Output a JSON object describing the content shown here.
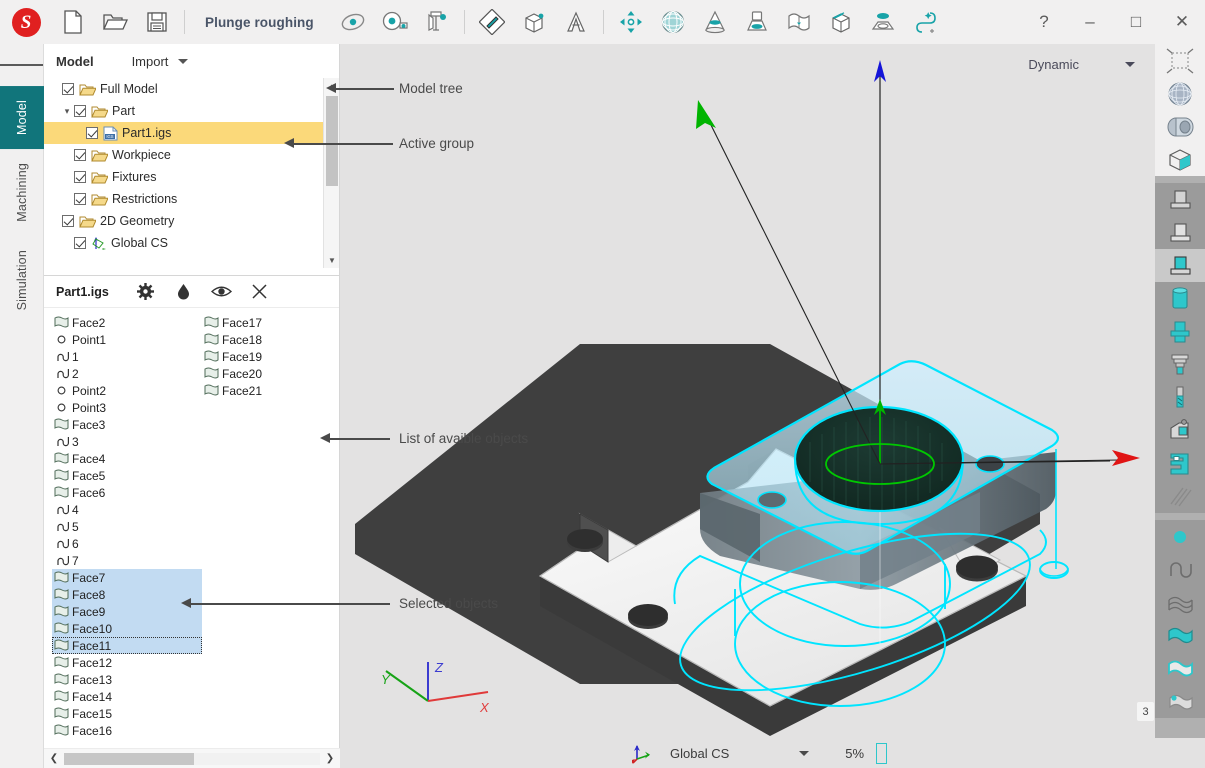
{
  "titlebar": {
    "logo_letter": "S",
    "document_title": "Plunge roughing",
    "left_icons": [
      {
        "name": "new-file-icon"
      },
      {
        "name": "open-folder-icon"
      },
      {
        "name": "save-icon"
      }
    ],
    "center_icons": [
      {
        "name": "measure-distance-icon"
      },
      {
        "name": "measure-tape-icon"
      },
      {
        "name": "caliper-icon"
      },
      {
        "name": "sketch-pencil-icon"
      },
      {
        "name": "solid-box-icon"
      },
      {
        "name": "text-annotation-icon"
      },
      {
        "name": "move-transform-icon"
      },
      {
        "name": "mesh-sphere-icon"
      },
      {
        "name": "cone-icon"
      },
      {
        "name": "turn-stock-icon"
      },
      {
        "name": "surface-wave-icon"
      },
      {
        "name": "extrude-box-icon"
      },
      {
        "name": "pocket-icon"
      },
      {
        "name": "toolpath-curve-icon"
      }
    ],
    "window_buttons": [
      {
        "name": "help-button",
        "glyph": "?"
      },
      {
        "name": "minimize-button",
        "glyph": "–"
      },
      {
        "name": "maximize-button",
        "glyph": "□"
      },
      {
        "name": "close-button",
        "glyph": "✕"
      }
    ]
  },
  "rail": {
    "menu_icon": "hamburger-menu-icon",
    "tabs": [
      {
        "label": "Model",
        "active": true
      },
      {
        "label": "Machining",
        "active": false
      },
      {
        "label": "Simulation",
        "active": false
      }
    ]
  },
  "tree_panel": {
    "title": "Model",
    "import_label": "Import",
    "items": [
      {
        "label": "Full Model",
        "indent": 0,
        "icon": "folder-icon",
        "checked": true,
        "twist": "",
        "selected": false
      },
      {
        "label": "Part",
        "indent": 1,
        "icon": "folder-icon",
        "checked": true,
        "twist": "⌄",
        "selected": false
      },
      {
        "label": "Part1.igs",
        "indent": 2,
        "icon": "igs-file-icon",
        "checked": true,
        "twist": "",
        "selected": true
      },
      {
        "label": "Workpiece",
        "indent": 1,
        "icon": "folder-icon",
        "checked": true,
        "twist": "",
        "selected": false
      },
      {
        "label": "Fixtures",
        "indent": 1,
        "icon": "folder-icon",
        "checked": true,
        "twist": "",
        "selected": false
      },
      {
        "label": "Restrictions",
        "indent": 1,
        "icon": "folder-icon",
        "checked": true,
        "twist": "",
        "selected": false
      },
      {
        "label": "2D Geometry",
        "indent": 0,
        "icon": "folder-icon",
        "checked": true,
        "twist": "",
        "selected": false
      },
      {
        "label": "Global CS",
        "indent": 1,
        "icon": "coordinate-system-icon",
        "checked": true,
        "twist": "",
        "selected": false
      }
    ]
  },
  "object_panel": {
    "title": "Part1.igs",
    "header_icons": [
      {
        "name": "settings-gear-icon"
      },
      {
        "name": "color-drop-icon"
      },
      {
        "name": "visibility-eye-icon"
      },
      {
        "name": "close-panel-icon"
      }
    ],
    "column1": [
      {
        "label": "Face2",
        "icon": "face-icon",
        "state": "normal"
      },
      {
        "label": "Point1",
        "icon": "point-icon",
        "state": "normal"
      },
      {
        "label": "1",
        "icon": "curve-icon",
        "state": "normal"
      },
      {
        "label": "2",
        "icon": "curve-icon",
        "state": "normal"
      },
      {
        "label": "Point2",
        "icon": "point-icon",
        "state": "normal"
      },
      {
        "label": "Point3",
        "icon": "point-icon",
        "state": "normal"
      },
      {
        "label": "Face3",
        "icon": "face-icon",
        "state": "normal"
      },
      {
        "label": "3",
        "icon": "curve-icon",
        "state": "normal"
      },
      {
        "label": "Face4",
        "icon": "face-icon",
        "state": "normal"
      },
      {
        "label": "Face5",
        "icon": "face-icon",
        "state": "normal"
      },
      {
        "label": "Face6",
        "icon": "face-icon",
        "state": "normal"
      },
      {
        "label": "4",
        "icon": "curve-icon",
        "state": "normal"
      },
      {
        "label": "5",
        "icon": "curve-icon",
        "state": "normal"
      },
      {
        "label": "6",
        "icon": "curve-icon",
        "state": "normal"
      },
      {
        "label": "7",
        "icon": "curve-icon",
        "state": "normal"
      },
      {
        "label": "Face7",
        "icon": "face-icon",
        "state": "selected"
      },
      {
        "label": "Face8",
        "icon": "face-icon",
        "state": "selected"
      },
      {
        "label": "Face9",
        "icon": "face-icon",
        "state": "selected"
      },
      {
        "label": "Face10",
        "icon": "face-icon",
        "state": "selected"
      },
      {
        "label": "Face11",
        "icon": "face-icon",
        "state": "focused"
      },
      {
        "label": "Face12",
        "icon": "face-icon",
        "state": "normal"
      },
      {
        "label": "Face13",
        "icon": "face-icon",
        "state": "normal"
      },
      {
        "label": "Face14",
        "icon": "face-icon",
        "state": "normal"
      },
      {
        "label": "Face15",
        "icon": "face-icon",
        "state": "normal"
      },
      {
        "label": "Face16",
        "icon": "face-icon",
        "state": "normal"
      }
    ],
    "column2": [
      {
        "label": "Face17",
        "icon": "face-icon",
        "state": "normal"
      },
      {
        "label": "Face18",
        "icon": "face-icon",
        "state": "normal"
      },
      {
        "label": "Face19",
        "icon": "face-icon",
        "state": "normal"
      },
      {
        "label": "Face20",
        "icon": "face-icon",
        "state": "normal"
      },
      {
        "label": "Face21",
        "icon": "face-icon",
        "state": "normal"
      }
    ]
  },
  "viewport": {
    "view_mode": "Dynamic",
    "axis_labels": {
      "x": "X",
      "y": "Y",
      "z": "Z"
    },
    "status": {
      "cs_icon": "coordinate-system-icon",
      "cs_name": "Global CS",
      "zoom": "5%",
      "scale_bar_icon": "scale-bar-icon"
    }
  },
  "right_toolbar": {
    "groups": [
      {
        "theme": "light",
        "buttons": [
          {
            "name": "bounding-box-icon",
            "selected": false
          },
          {
            "name": "wireframe-sphere-icon",
            "selected": false
          },
          {
            "name": "shaded-solid-icon",
            "selected": false
          },
          {
            "name": "transparent-box-icon",
            "selected": false
          }
        ]
      },
      {
        "theme": "dark",
        "buttons": [
          {
            "name": "stock-model-gray-icon",
            "selected": false
          },
          {
            "name": "stock-model-outline-icon",
            "selected": false
          },
          {
            "name": "stock-model-teal-icon",
            "selected": true
          },
          {
            "name": "solid-cylinder-teal-icon",
            "selected": false
          },
          {
            "name": "stepped-cylinder-icon",
            "selected": false
          },
          {
            "name": "tool-holder-icon",
            "selected": false
          },
          {
            "name": "endmill-tool-icon",
            "selected": false
          },
          {
            "name": "machine-head-icon",
            "selected": false
          },
          {
            "name": "clamp-fixture-icon",
            "selected": false
          },
          {
            "name": "hatch-pattern-icon",
            "selected": false
          }
        ]
      },
      {
        "theme": "dark",
        "buttons": [
          {
            "name": "point-dot-icon",
            "selected": false
          },
          {
            "name": "curve-icon",
            "selected": false
          },
          {
            "name": "surface-mesh-icon",
            "selected": false
          },
          {
            "name": "surface-teal-icon",
            "selected": false
          },
          {
            "name": "surface-highlight-icon",
            "selected": false
          },
          {
            "name": "surface-point-icon",
            "selected": false
          }
        ]
      }
    ],
    "badge_count": "3"
  },
  "annotations": [
    {
      "text": "Model tree",
      "name": "annotation-model-tree"
    },
    {
      "text": "Active group",
      "name": "annotation-active-group"
    },
    {
      "text": "List of avaible objects",
      "name": "annotation-object-list"
    },
    {
      "text": "Selected objects",
      "name": "annotation-selected-objects"
    }
  ],
  "colors": {
    "accent_teal": "#18a3a8",
    "active_tab": "#11757b",
    "selection_yellow": "#fbd97a",
    "selection_blue": "#c2dbf2",
    "logo_red": "#e02020"
  }
}
